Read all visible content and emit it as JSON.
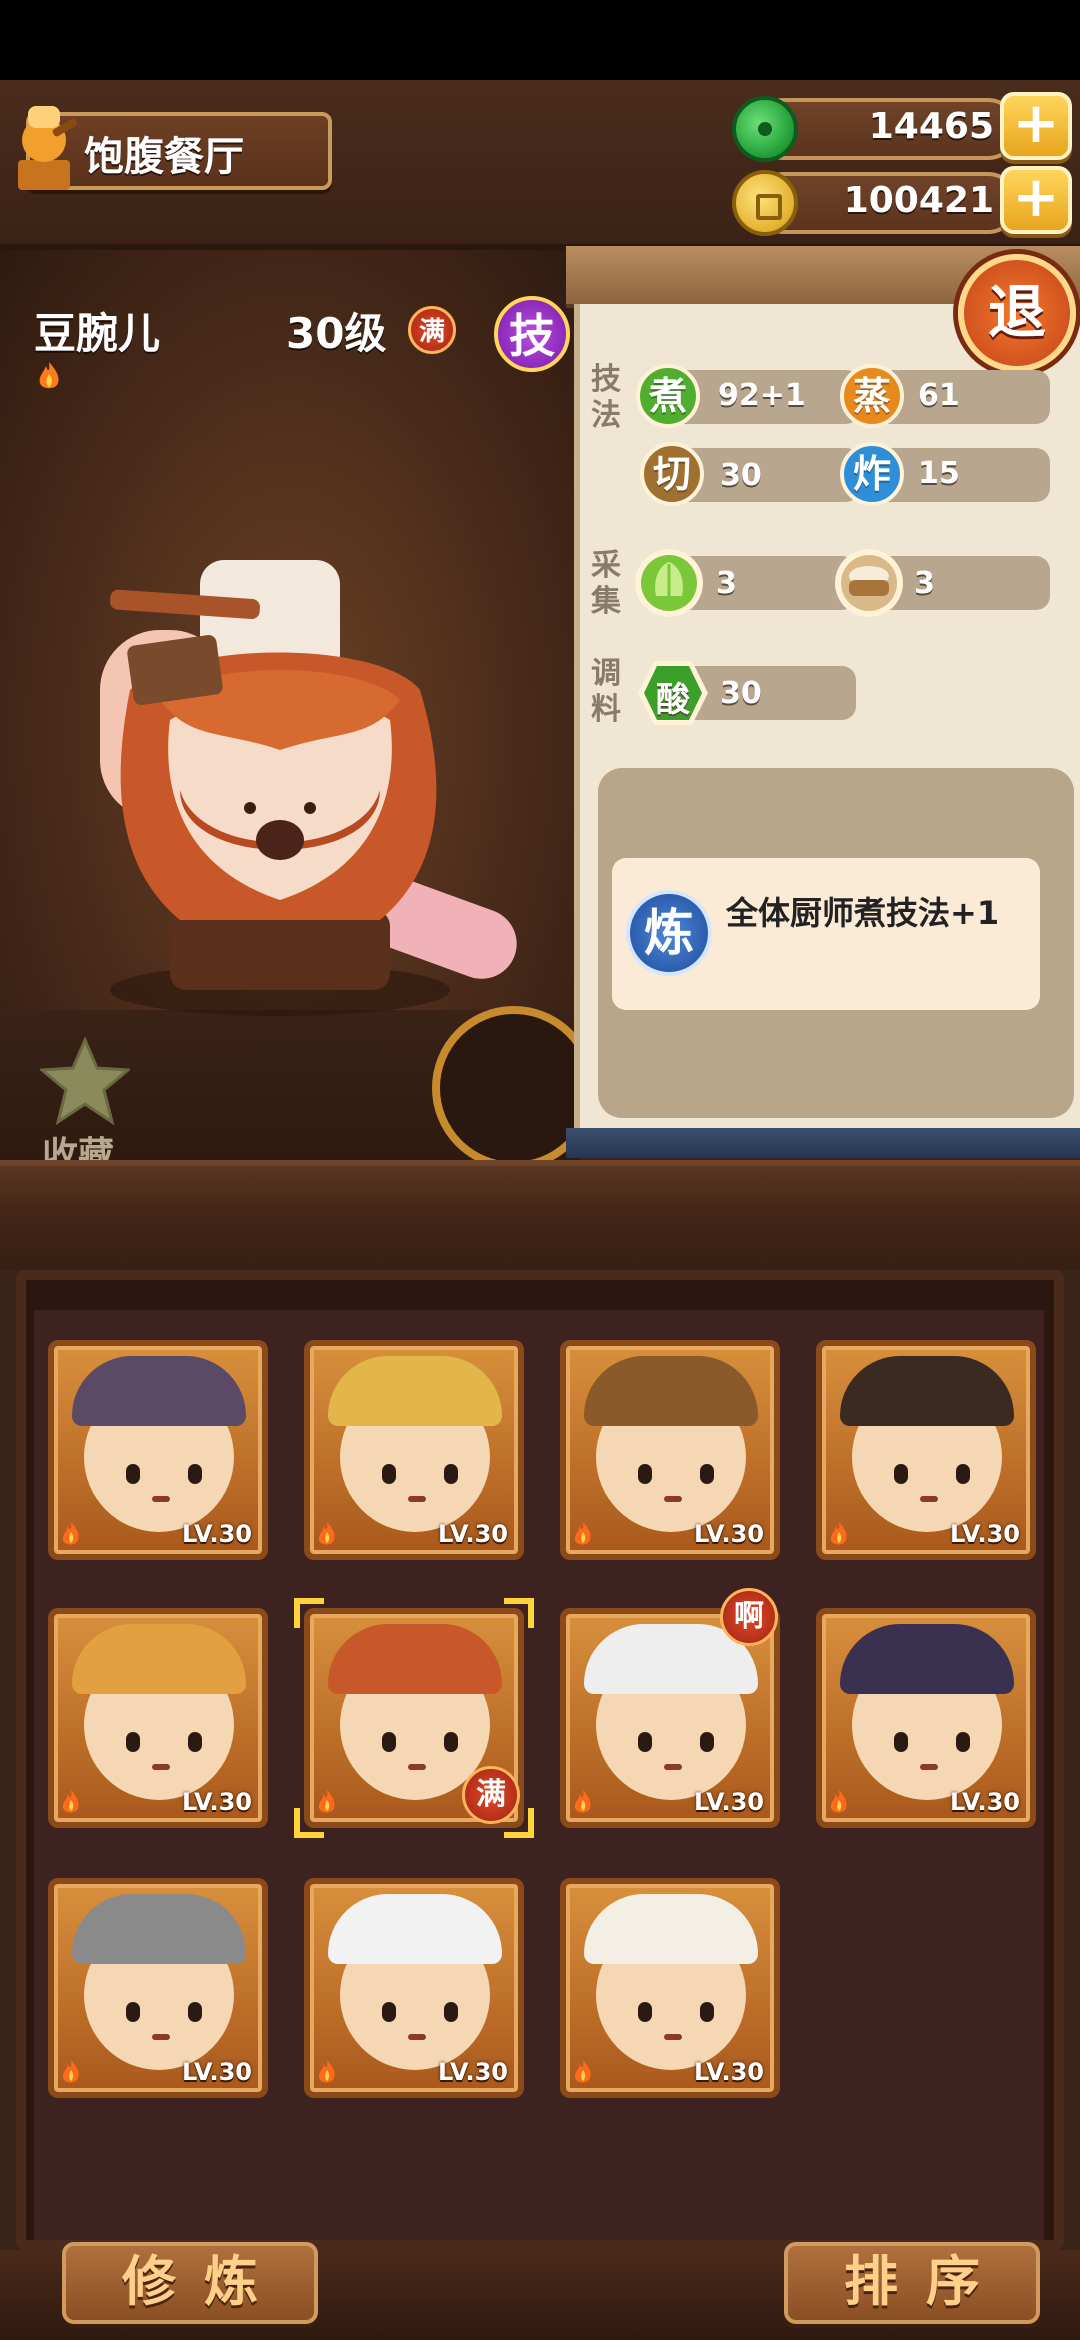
{
  "header": {
    "restaurant_name": "饱腹餐厅",
    "currencies": [
      {
        "icon": "jade-icon",
        "value": "14465"
      },
      {
        "icon": "coin-icon",
        "value": "100421"
      }
    ],
    "plus_label": "+"
  },
  "character": {
    "name": "豆腕儿",
    "level": "30级",
    "full_badge": "满",
    "skill_badge": "技",
    "favorite_label": "收藏"
  },
  "info_panel": {
    "quit_label": "退",
    "sections": [
      {
        "label": "技法",
        "stats": [
          {
            "icon_char": "煮",
            "value": "92+1",
            "color": "#4fae2e"
          },
          {
            "icon_char": "蒸",
            "value": "61",
            "color": "#e8891e"
          },
          {
            "icon_char": "切",
            "value": "30",
            "color": "#a07030"
          },
          {
            "icon_char": "炸",
            "value": "15",
            "color": "#2e8fd8"
          }
        ]
      },
      {
        "label": "采集",
        "stats": [
          {
            "icon": "cabbage-icon",
            "value": "3"
          },
          {
            "icon": "grain-basket-icon",
            "value": "3"
          }
        ]
      },
      {
        "label": "调料",
        "stats": [
          {
            "icon_char": "酸",
            "value": "30",
            "color": "#3aa02a"
          }
        ]
      }
    ],
    "skill": {
      "icon_char": "炼",
      "description": "全体厨师煮技法+1"
    }
  },
  "roster": [
    {
      "level": "LV.30",
      "hat_color": "#5a4a66"
    },
    {
      "level": "LV.30",
      "hat_color": "#e2b64a"
    },
    {
      "level": "LV.30",
      "hat_color": "#8a5a2a"
    },
    {
      "level": "LV.30",
      "hat_color": "#3a2a22"
    },
    {
      "level": "LV.30",
      "hat_color": "#e2a040"
    },
    {
      "level": "",
      "hat_color": "#c8582a",
      "badge": "满",
      "selected": true
    },
    {
      "level": "LV.30",
      "hat_color": "#eeeeee",
      "badge": "啊"
    },
    {
      "level": "LV.30",
      "hat_color": "#3a3050"
    },
    {
      "level": "LV.30",
      "hat_color": "#8a8a8a"
    },
    {
      "level": "LV.30",
      "hat_color": "#f2f2f2"
    },
    {
      "level": "LV.30",
      "hat_color": "#f4efe4"
    }
  ],
  "bottom": {
    "left_button": "修炼",
    "right_button": "排序"
  },
  "colors": {
    "accent_gold": "#e8a51d",
    "wood_dark": "#3a2418",
    "panel_bg": "#efe6d4"
  }
}
